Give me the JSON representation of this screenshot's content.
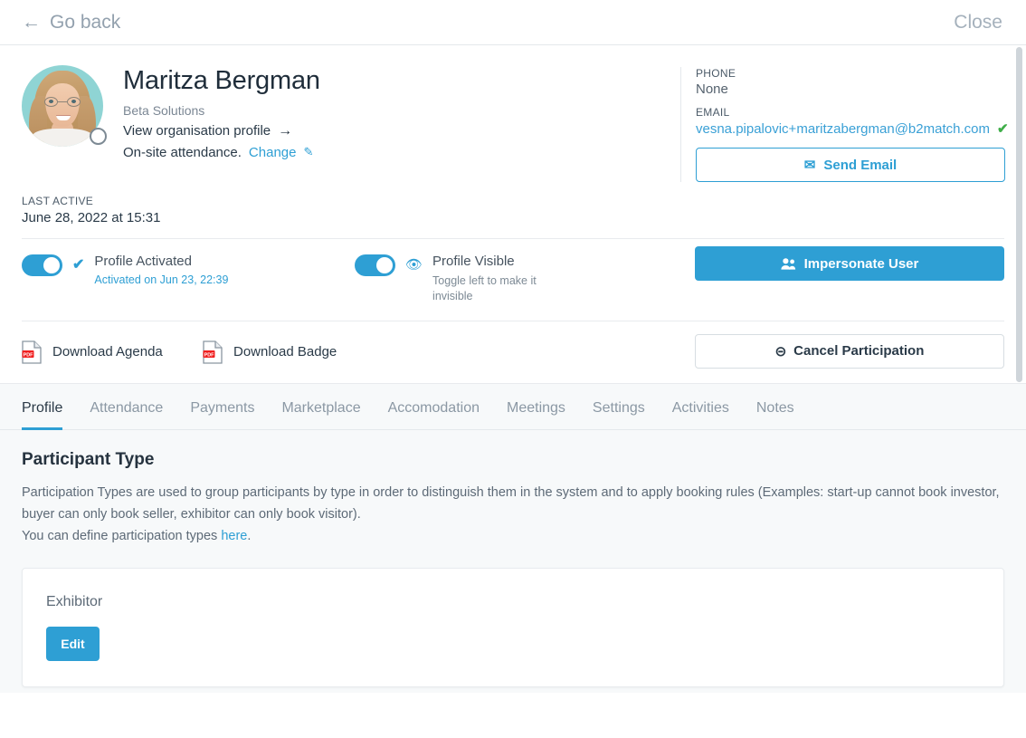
{
  "topbar": {
    "back_label": "Go back",
    "back_icon": "arrow-left-icon",
    "close_label": "Close"
  },
  "identity": {
    "name": "Maritza Bergman",
    "organisation": "Beta Solutions",
    "view_org_link": "View organisation profile",
    "view_org_arrow": "→",
    "attendance_text": "On-site attendance.",
    "attendance_change": "Change",
    "change_icon": "pencil-icon",
    "avatar_icon": "user-avatar-photo"
  },
  "contact": {
    "phone_label": "PHONE",
    "phone_value": "None",
    "email_label": "EMAIL",
    "email_value": "vesna.pipalovic+maritzabergman@b2match.com",
    "email_verified_icon": "check-green-icon",
    "send_email_label": "Send Email",
    "send_email_icon": "envelope-icon"
  },
  "last_active": {
    "label": "LAST ACTIVE",
    "value": "June 28, 2022 at 15:31"
  },
  "toggles": {
    "activated": {
      "title": "Profile Activated",
      "subtitle": "Activated on Jun 23, 22:39",
      "state": "on",
      "icon": "check-icon"
    },
    "visible": {
      "title": "Profile Visible",
      "subtitle": "Toggle left to make it invisible",
      "state": "on",
      "icon": "eye-icon"
    },
    "impersonate_label": "Impersonate User",
    "impersonate_icon": "users-icon"
  },
  "downloads": {
    "agenda_label": "Download Agenda",
    "badge_label": "Download Badge",
    "pdf_icon": "pdf-file-icon",
    "cancel_label": "Cancel Participation",
    "cancel_icon": "circle-x-icon"
  },
  "tabs": [
    {
      "label": "Profile",
      "active": true
    },
    {
      "label": "Attendance",
      "active": false
    },
    {
      "label": "Payments",
      "active": false
    },
    {
      "label": "Marketplace",
      "active": false
    },
    {
      "label": "Accomodation",
      "active": false
    },
    {
      "label": "Meetings",
      "active": false
    },
    {
      "label": "Settings",
      "active": false
    },
    {
      "label": "Activities",
      "active": false
    },
    {
      "label": "Notes",
      "active": false
    }
  ],
  "section": {
    "title": "Participant Type",
    "paragraph": "Participation Types are used to group participants by type in order to distinguish them in the system and to apply booking rules (Examples: start-up cannot book investor, buyer can only book seller, exhibitor can only book visitor).",
    "define_prefix": "You can define participation types ",
    "define_link": "here",
    "define_suffix": ".",
    "card_value": "Exhibitor",
    "edit_label": "Edit"
  },
  "colors": {
    "accent": "#2e9fd4",
    "text_dark": "#2a3a48",
    "text_muted": "#7b8794",
    "success": "#3fae49",
    "pdf_red": "#f01f1f",
    "page_bg": "#f7f9fa"
  }
}
